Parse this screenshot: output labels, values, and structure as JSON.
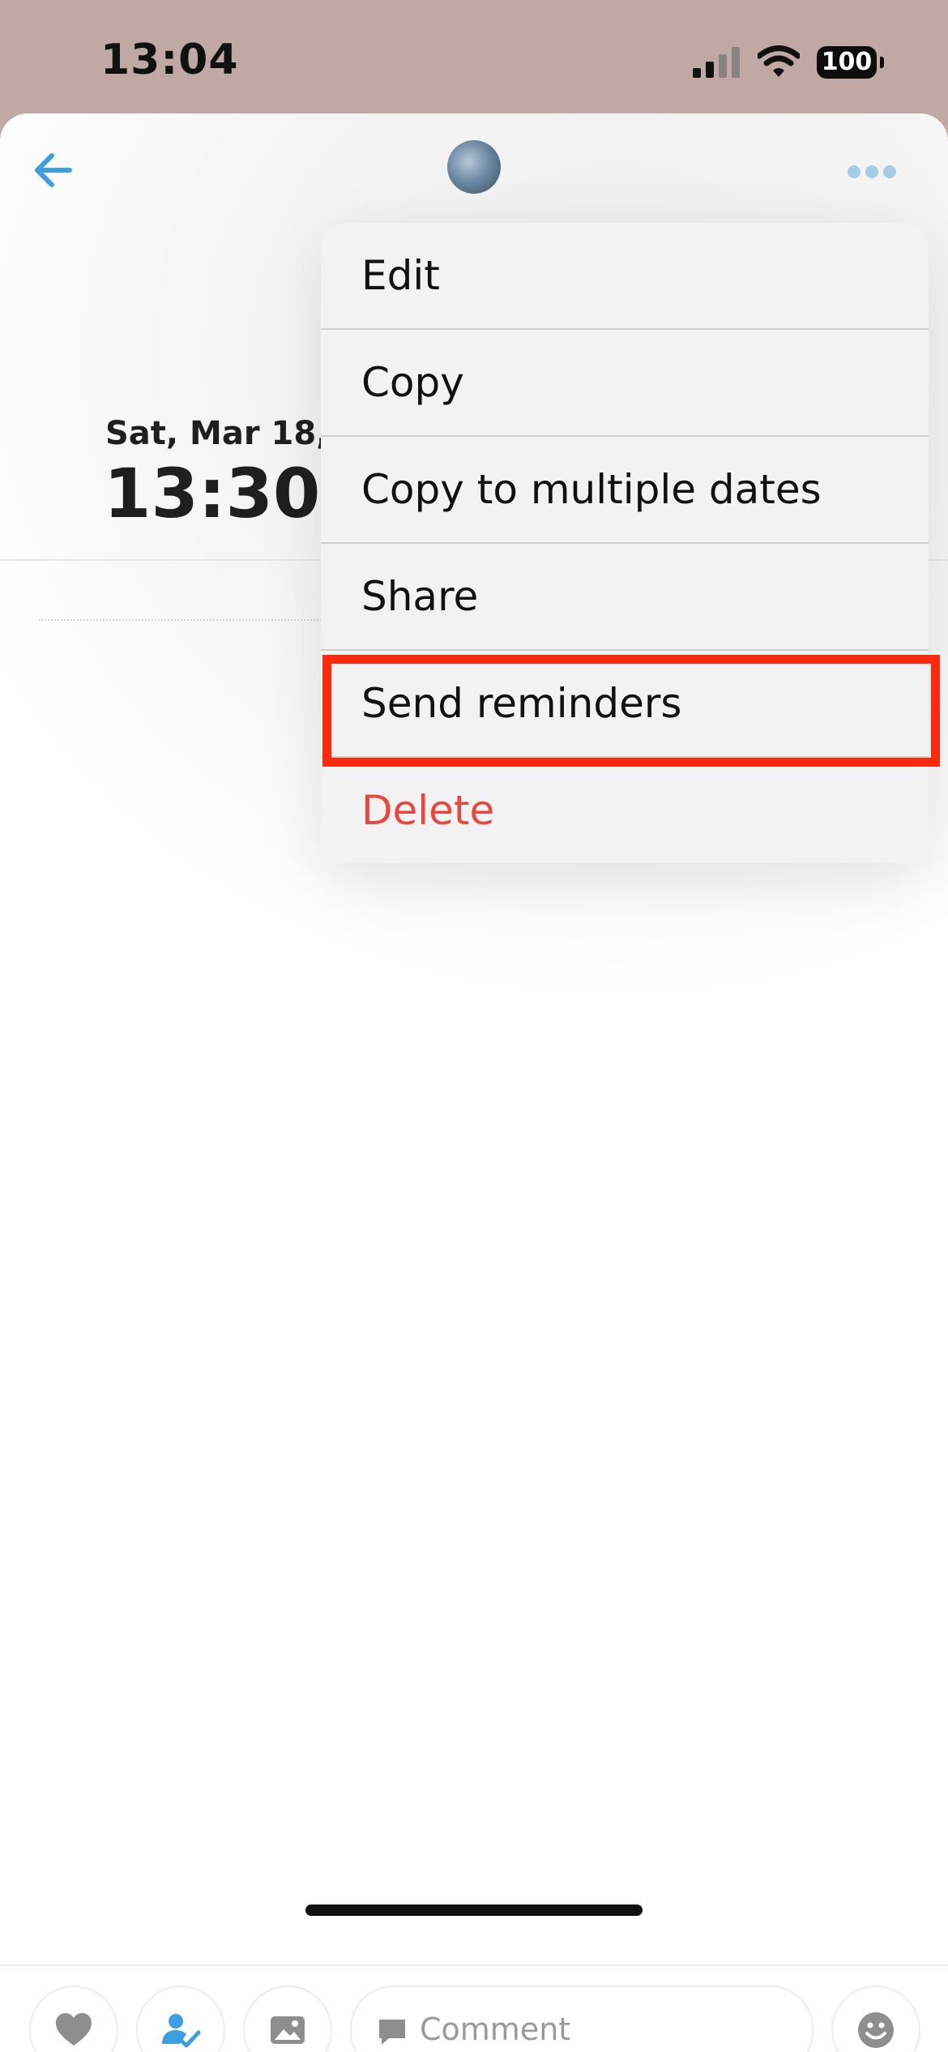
{
  "status_bar": {
    "time": "13:04",
    "battery": "100"
  },
  "header": {
    "back_icon": "arrow-left-icon",
    "more_icon": "ellipsis-icon"
  },
  "event": {
    "date": "Sat, Mar 18,",
    "time": "13:30"
  },
  "menu": {
    "items": [
      {
        "label": "Edit"
      },
      {
        "label": "Copy"
      },
      {
        "label": "Copy to multiple dates"
      },
      {
        "label": "Share"
      },
      {
        "label": "Send reminders",
        "highlighted": true
      },
      {
        "label": "Delete",
        "destructive": true
      }
    ]
  },
  "toolbar": {
    "comment_placeholder": "Comment",
    "icons": [
      "heart-icon",
      "person-check-icon",
      "image-icon",
      "comment-icon",
      "emoji-icon"
    ]
  },
  "colors": {
    "accent_blue": "#3e9fe0",
    "destructive_red": "#e5483f",
    "highlight_red": "#f92a0d",
    "background_mauve": "#c0a9a5"
  }
}
